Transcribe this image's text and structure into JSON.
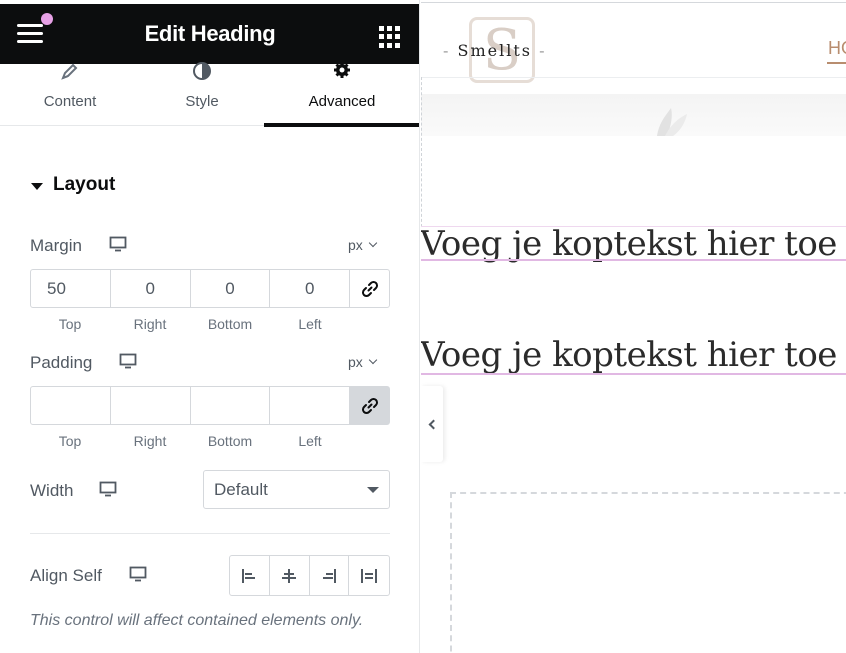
{
  "panel": {
    "title": "Edit Heading",
    "tabs": [
      {
        "label": "Content",
        "icon": "pencil-icon"
      },
      {
        "label": "Style",
        "icon": "half-circle-icon"
      },
      {
        "label": "Advanced",
        "icon": "gear-icon",
        "active": true
      }
    ],
    "section": {
      "title": "Layout"
    },
    "margin": {
      "label": "Margin",
      "unit": "px",
      "values": {
        "top": "50",
        "right": "0",
        "bottom": "0",
        "left": "0"
      },
      "linked": false,
      "sublabels": [
        "Top",
        "Right",
        "Bottom",
        "Left"
      ]
    },
    "padding": {
      "label": "Padding",
      "unit": "px",
      "values": {
        "top": "",
        "right": "",
        "bottom": "",
        "left": ""
      },
      "linked": true,
      "sublabels": [
        "Top",
        "Right",
        "Bottom",
        "Left"
      ]
    },
    "width": {
      "label": "Width",
      "value": "Default"
    },
    "align_self": {
      "label": "Align Self",
      "options": [
        "align-start-icon",
        "align-center-icon",
        "align-end-icon",
        "align-stretch-icon"
      ]
    },
    "note": "This control will affect contained elements only."
  },
  "preview": {
    "logo_text": "Smellts",
    "logo_dash": "-",
    "logo_letter": "S",
    "nav_item": "HO",
    "headings": [
      "Voeg je koptekst hier toe",
      "Voeg je koptekst hier toe"
    ]
  },
  "colors": {
    "header_bg": "#0c0d0e",
    "notification_dot": "#e7a1e6",
    "heading_outline": "#e1b8e3",
    "nav_accent": "#b88d6f"
  }
}
